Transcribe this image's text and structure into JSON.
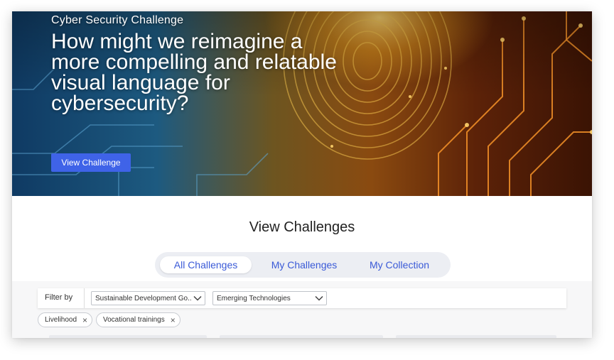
{
  "hero": {
    "eyebrow": "Cyber Security Challenge",
    "title": "How might we reimagine a more compelling and relatable visual language for cybersecurity?",
    "button_label": "View Challenge"
  },
  "section": {
    "title": "View Challenges"
  },
  "tabs": [
    {
      "label": "All Challenges",
      "active": true
    },
    {
      "label": "My Challenges",
      "active": false
    },
    {
      "label": "My Collection",
      "active": false
    }
  ],
  "filter": {
    "label": "Filter by",
    "selects": [
      {
        "value": "Sustainable Development Go...",
        "icon": "chevron-down-icon"
      },
      {
        "value": "Emerging Technologies",
        "icon": "chevron-down-icon"
      }
    ]
  },
  "chips": [
    {
      "label": "Livelihood",
      "remove_icon": "×"
    },
    {
      "label": "Vocational trainings",
      "remove_icon": "×"
    }
  ],
  "colors": {
    "accent": "#3f63e8",
    "tab_text": "#3a5ad7",
    "tabs_bg": "#eceef3"
  }
}
